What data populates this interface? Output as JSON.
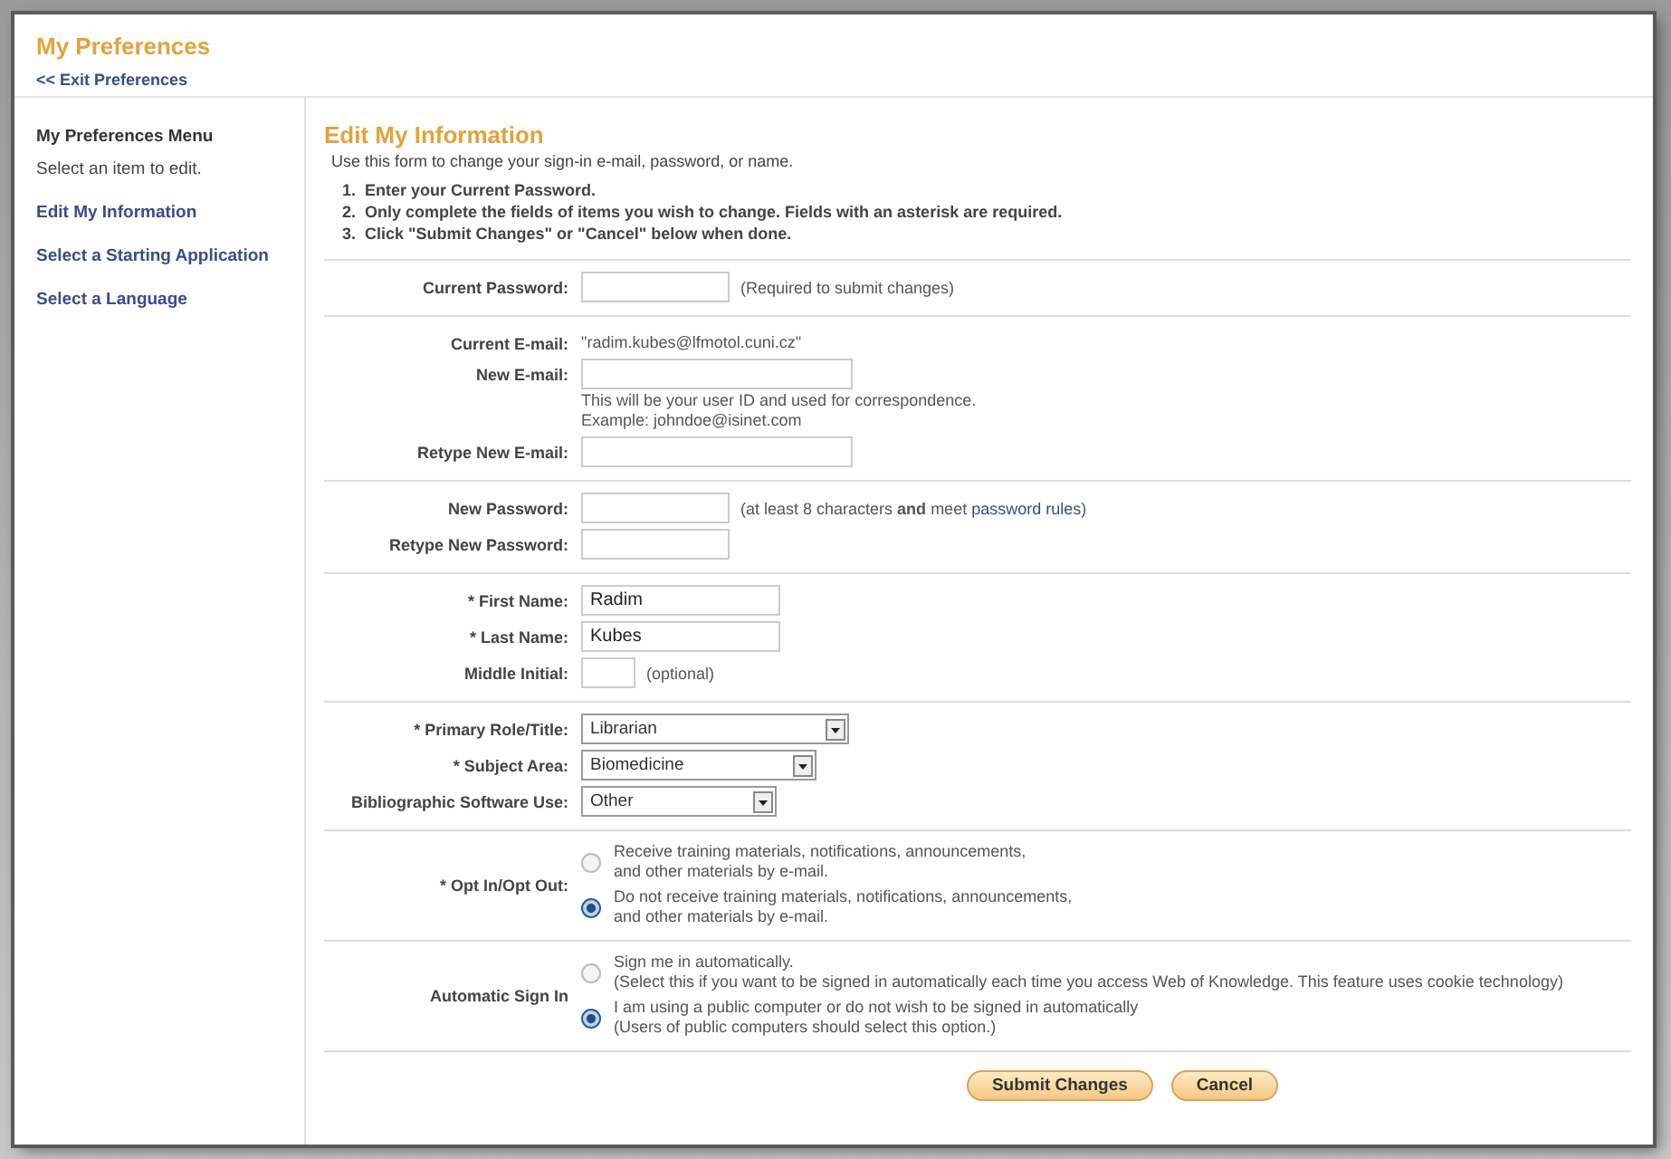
{
  "header": {
    "title": "My Preferences",
    "exit_link": "<< Exit Preferences"
  },
  "sidebar": {
    "heading": "My Preferences Menu",
    "hint": "Select an item to edit.",
    "items": [
      {
        "label": "Edit My Information"
      },
      {
        "label": "Select a Starting Application"
      },
      {
        "label": "Select a Language"
      }
    ]
  },
  "form": {
    "title": "Edit My Information",
    "intro": "Use this form to change your sign-in e-mail, password, or name.",
    "steps": [
      "1.  Enter your Current Password.",
      "2.  Only complete the fields of items you wish to change. Fields with an asterisk are required.",
      "3.  Click \"Submit Changes\" or \"Cancel\" below when done."
    ],
    "sections": [
      {
        "fields": [
          {
            "kind": "input",
            "label": "Current Password:",
            "note": "(Required to submit changes)"
          }
        ]
      },
      {
        "fields": [
          {
            "kind": "text",
            "label": "Current E-mail:",
            "value": "\"radim.kubes@lfmotol.cuni.cz\""
          },
          {
            "kind": "input",
            "label": "New E-mail:",
            "help": [
              "This will be your user ID and used for correspondence.",
              "Example: johndoe@isinet.com"
            ]
          },
          {
            "kind": "input",
            "label": "Retype New E-mail:"
          }
        ]
      },
      {
        "fields": [
          {
            "kind": "input",
            "label": "New Password:",
            "note": "(at least 8 characters **and** meet ",
            "note_link": "password rules",
            "note_end": ")"
          },
          {
            "kind": "input",
            "label": "Retype New Password:"
          }
        ]
      },
      {
        "fields": [
          {
            "kind": "input",
            "label": "* First Name:",
            "value": "Radim"
          },
          {
            "kind": "input",
            "label": "* Last Name:",
            "value": "Kubes"
          },
          {
            "kind": "input",
            "label": "Middle Initial:",
            "note": "(optional)"
          }
        ]
      },
      {
        "fields": [
          {
            "kind": "select",
            "label": "* Primary Role/Title:",
            "value": "Librarian"
          },
          {
            "kind": "select",
            "label": "* Subject Area:",
            "value": "Biomedicine"
          },
          {
            "kind": "select",
            "label": "Bibliographic Software Use:",
            "value": "Other"
          }
        ]
      },
      {
        "fields": [
          {
            "kind": "radio",
            "label": "* Opt In/Opt Out:",
            "options": [
              {
                "lines": [
                  "Receive training materials, notifications, announcements,",
                  "and other materials by e-mail."
                ],
                "selected": false
              },
              {
                "lines": [
                  "Do not receive training materials, notifications, announcements,",
                  "and other materials by e-mail."
                ],
                "selected": true
              }
            ]
          }
        ]
      },
      {
        "fields": [
          {
            "kind": "radio",
            "label": "Automatic Sign In",
            "options": [
              {
                "lines": [
                  "Sign me in automatically.",
                  "(Select this if you want to be signed in automatically each time you access Web of Knowledge. This feature uses cookie technology)"
                ],
                "selected": false
              },
              {
                "lines": [
                  "I am using a public computer or do not wish to be signed in automatically",
                  "(Users of public computers should select this option.)"
                ],
                "selected": true
              }
            ]
          }
        ]
      }
    ],
    "buttons": [
      "Submit Changes",
      "Cancel"
    ]
  }
}
